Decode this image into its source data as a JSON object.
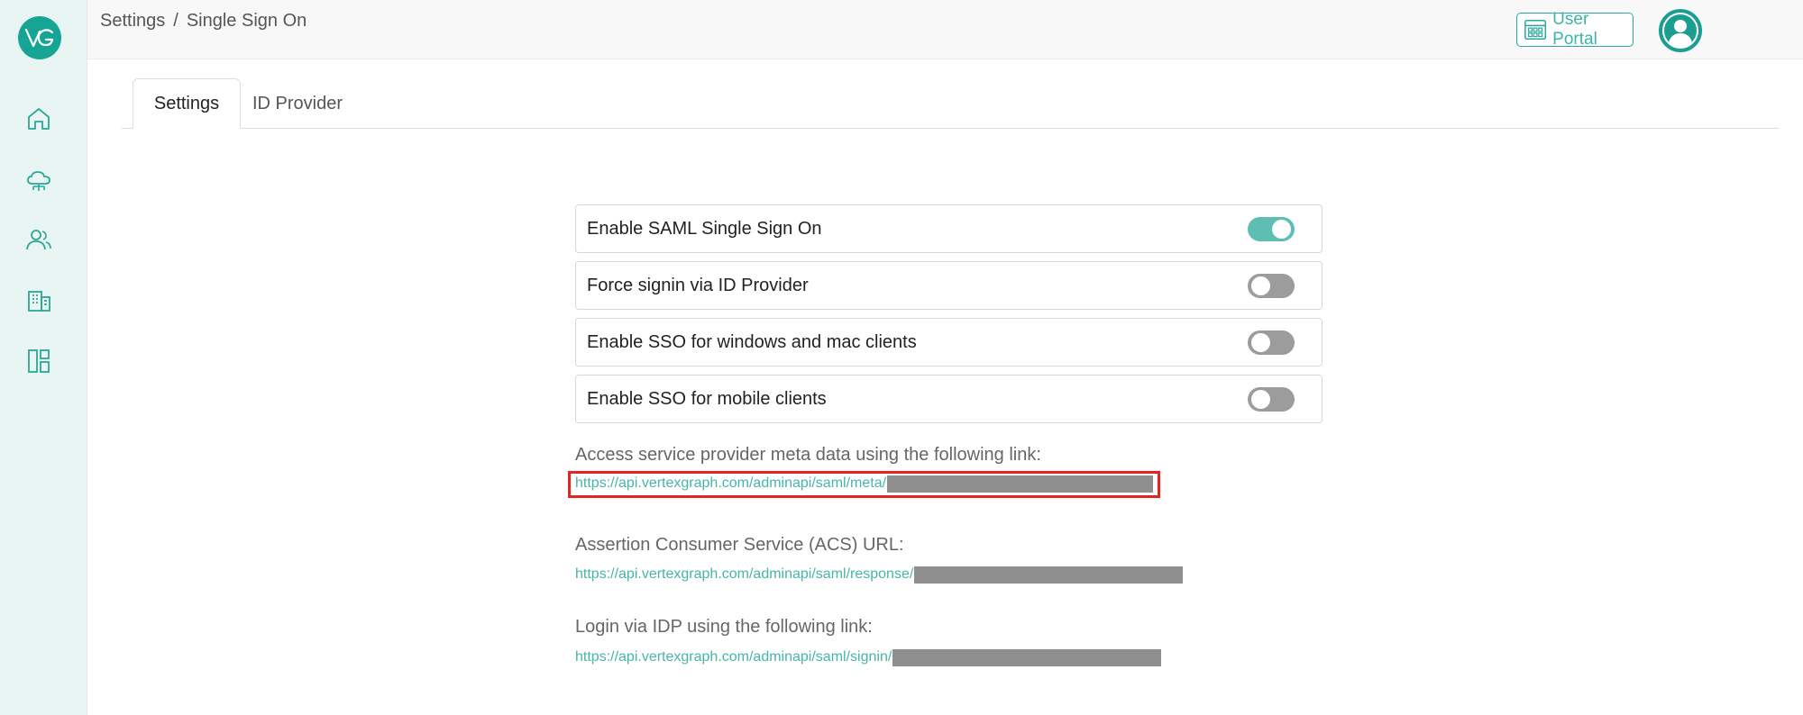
{
  "sidebar": {
    "logo_text": "VG",
    "icons": [
      "home-icon",
      "cloud-network-icon",
      "users-icon",
      "building-icon",
      "dashboard-layout-icon"
    ]
  },
  "breadcrumb": {
    "root": "Settings",
    "separator": "/",
    "current": "Single Sign On"
  },
  "header": {
    "portal_label": "User Portal",
    "portal_icon": "grid-calendar-icon",
    "avatar_icon": "user-avatar-icon"
  },
  "tabs": [
    {
      "label": "Settings",
      "active": true
    },
    {
      "label": "ID Provider",
      "active": false
    }
  ],
  "settings": [
    {
      "label": "Enable SAML Single Sign On",
      "enabled": true
    },
    {
      "label": "Force signin via ID Provider",
      "enabled": false
    },
    {
      "label": "Enable SSO for windows and mac clients",
      "enabled": false
    },
    {
      "label": "Enable SSO for mobile clients",
      "enabled": false
    }
  ],
  "links": {
    "meta": {
      "label": "Access service provider meta data using the following link:",
      "url": "https://api.vertexgraph.com/adminapi/saml/meta/"
    },
    "acs": {
      "label": "Assertion Consumer Service (ACS) URL:",
      "url": "https://api.vertexgraph.com/adminapi/saml/response/"
    },
    "login": {
      "label": "Login via IDP using the following link:",
      "url": "https://api.vertexgraph.com/adminapi/saml/signin/"
    }
  },
  "colors": {
    "accent": "#16a495",
    "link": "#47b5a8",
    "highlight": "#e0261e",
    "toggle_on": "#5fbeb3",
    "toggle_off": "#9c9c9c"
  }
}
